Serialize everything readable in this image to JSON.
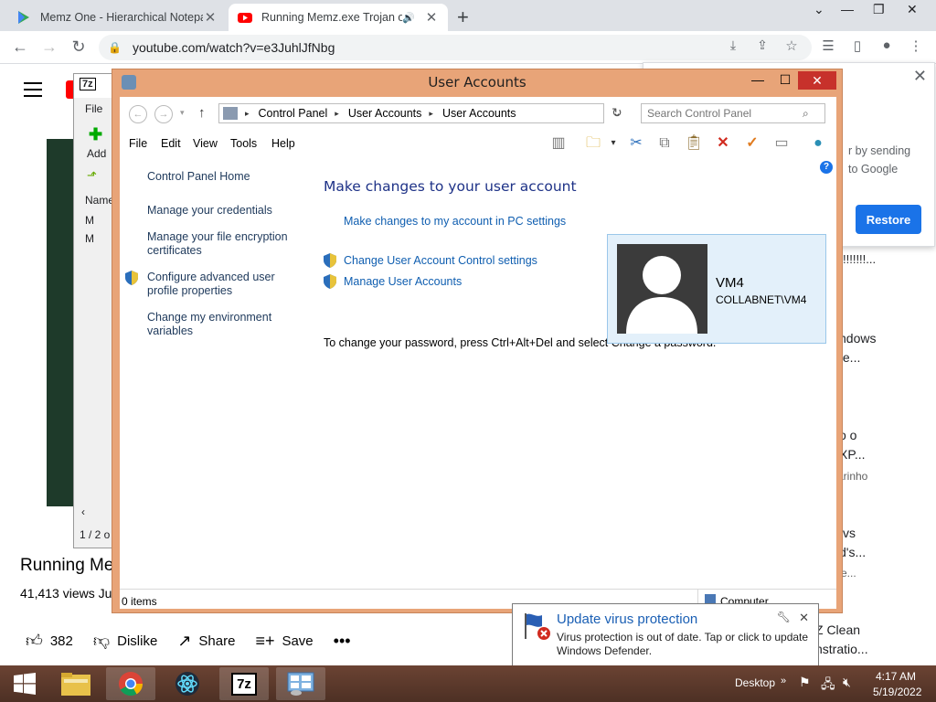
{
  "browser": {
    "tabs": [
      {
        "title": "Memz One - Hierarchical Notepad",
        "icon": "play-store-icon"
      },
      {
        "title": "Running Memz.exe Trojan on",
        "icon": "youtube-icon"
      }
    ],
    "url": "youtube.com/watch?v=e3JuhlJfNbg"
  },
  "youtube": {
    "video_title": "Running Mem",
    "views": "41,413 views  Ju",
    "actions": {
      "likes": "382",
      "dislike": "Dislike",
      "share": "Share",
      "save": "Save"
    },
    "right_col": [
      "!!!!!!!...",
      "ndows",
      "te...",
      "o o",
      "XP...",
      "arinho",
      "vs",
      "d's...",
      "e...",
      "Z Clean",
      "nstratio..."
    ]
  },
  "popup": {
    "text_line1": "r by sending",
    "text_line2": "to Google",
    "restore": "Restore"
  },
  "sevenzip": {
    "logo": "7z",
    "file_menu": "File",
    "add_label": "Add",
    "name_col": "Name",
    "rows": [
      "M",
      "M"
    ],
    "status": "1 / 2 o"
  },
  "user_accounts": {
    "title": "User Accounts",
    "breadcrumb": [
      "Control Panel",
      "User Accounts",
      "User Accounts"
    ],
    "search_placeholder": "Search Control Panel",
    "menu": [
      "File",
      "Edit",
      "View",
      "Tools",
      "Help"
    ],
    "left_pane": {
      "home": "Control Panel Home",
      "links": [
        "Manage your credentials",
        "Manage your file encryption certificates",
        "Configure advanced user profile properties",
        "Change my environment variables"
      ]
    },
    "heading": "Make changes to your user account",
    "pc_settings_link": "Make changes to my account in PC settings",
    "uac_link": "Change User Account Control settings",
    "manage_link": "Manage User Accounts",
    "password_note": "To change your password, press Ctrl+Alt+Del and select Change a password.",
    "account": {
      "name": "VM4",
      "domain": "COLLABNET\\VM4"
    },
    "status_items": "0 items",
    "status_location": "Computer"
  },
  "toast": {
    "title": "Update virus protection",
    "body": "Virus protection is out of date. Tap or click to update Windows Defender."
  },
  "taskbar": {
    "desktop_label": "Desktop",
    "time": "4:17 AM",
    "date": "5/19/2022"
  }
}
